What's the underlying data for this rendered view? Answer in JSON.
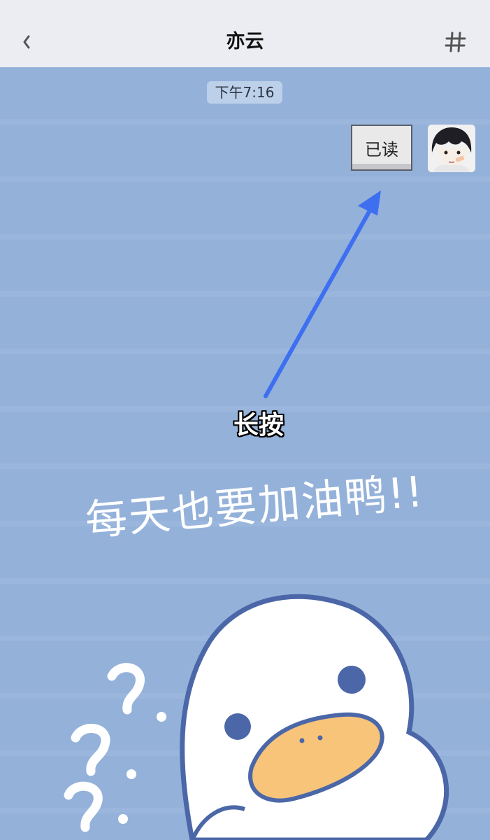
{
  "header": {
    "title": "亦云",
    "back_icon": "chevron-left-icon",
    "menu_icon": "hash-icon"
  },
  "chat": {
    "timestamp": "下午7:16",
    "message_text": "已读",
    "annotation_text": "长按",
    "wallpaper_text": "每天也要加油鸭!!"
  },
  "colors": {
    "header_bg": "#ecedf3",
    "chat_bg": "#94b1da",
    "arrow": "#3d6ff0",
    "duck_outline": "#4b67a8",
    "duck_beak": "#f7c47a"
  }
}
